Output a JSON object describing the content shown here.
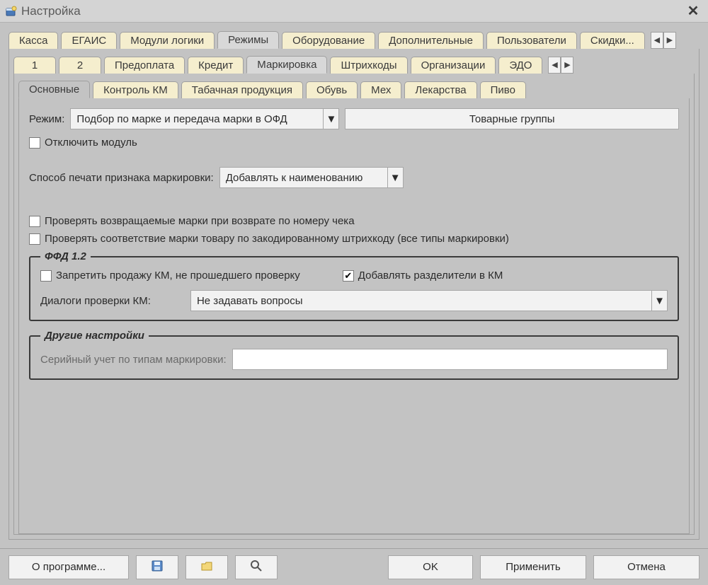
{
  "window": {
    "title": "Настройка"
  },
  "tabs_top": {
    "items": [
      "Касса",
      "ЕГАИС",
      "Модули логики",
      "Режимы",
      "Оборудование",
      "Дополнительные",
      "Пользователи",
      "Скидки..."
    ],
    "active_index": 3
  },
  "tabs_mid": {
    "items": [
      "1",
      "2",
      "Предоплата",
      "Кредит",
      "Маркировка",
      "Штрихкоды",
      "Организации",
      "ЭДО"
    ],
    "active_index": 4
  },
  "tabs_sub": {
    "items": [
      "Основные",
      "Контроль КМ",
      "Табачная продукция",
      "Обувь",
      "Мех",
      "Лекарства",
      "Пиво"
    ],
    "active_index": 0
  },
  "form": {
    "mode_label": "Режим:",
    "mode_value": "Подбор по марке и передача марки в ОФД",
    "groups_btn": "Товарные группы",
    "disable_module": {
      "label": "Отключить модуль",
      "checked": false
    },
    "print_method_label": "Способ печати признака маркировки:",
    "print_method_value": "Добавлять к наименованию",
    "check_return_marks": {
      "label": "Проверять возвращаемые марки при возврате по номеру чека",
      "checked": false
    },
    "check_mark_match": {
      "label": "Проверять соответствие марки товару по закодированному штрихкоду (все типы маркировки)",
      "checked": false
    },
    "ffd": {
      "legend": "ФФД 1.2",
      "forbid_sale": {
        "label": "Запретить продажу КМ, не прошедшего проверку",
        "checked": false
      },
      "add_separators": {
        "label": "Добавлять разделители в КМ",
        "checked": true
      },
      "dialogs_label": "Диалоги проверки КМ:",
      "dialogs_value": "Не задавать вопросы"
    },
    "other": {
      "legend": "Другие настройки",
      "serial_label": "Серийный учет по типам маркировки:",
      "serial_value": ""
    }
  },
  "bottom": {
    "about": "О программе...",
    "ok": "OK",
    "apply": "Применить",
    "cancel": "Отмена"
  }
}
